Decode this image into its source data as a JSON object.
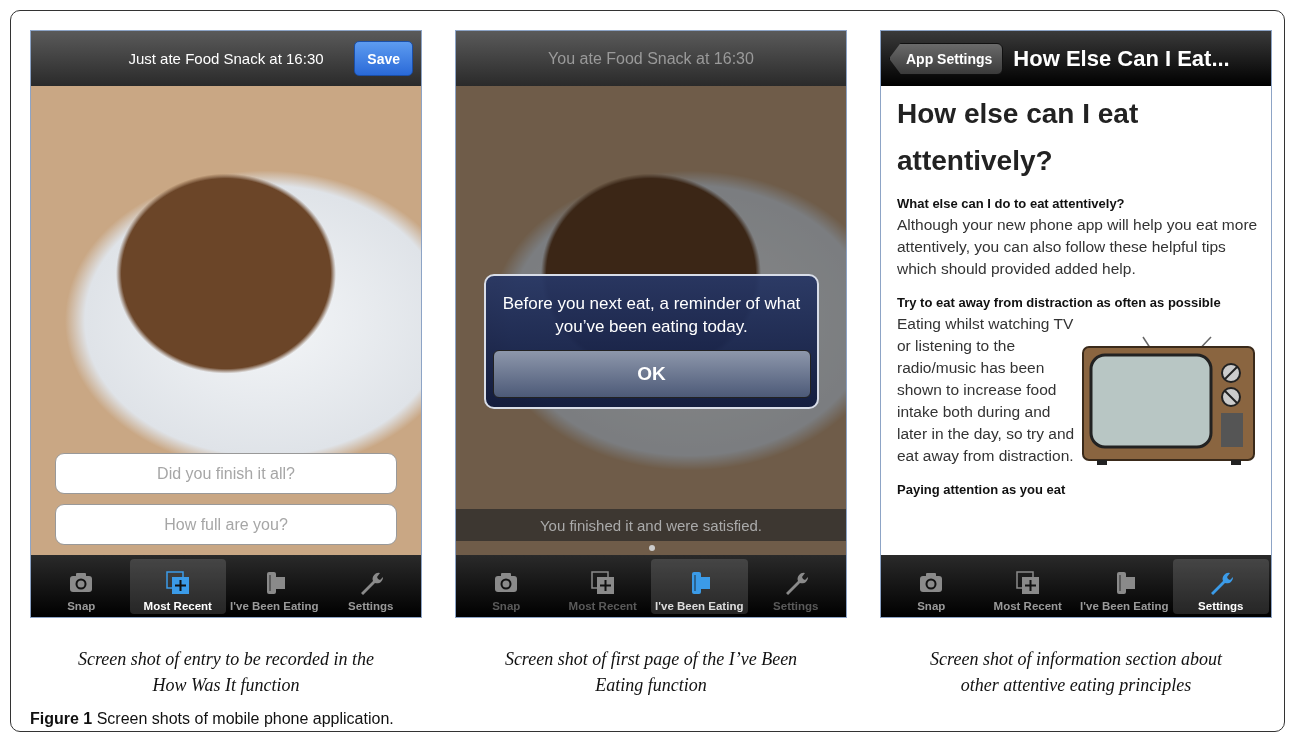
{
  "screens": [
    {
      "kind": "entry",
      "dimmed": false,
      "header": {
        "title": "Just ate Food Snack at 16:30",
        "button": "Save"
      },
      "fields": [
        {
          "placeholder": "Did you finish it all?"
        },
        {
          "placeholder": "How full are you?"
        }
      ],
      "tabs": [
        {
          "kind": "camera",
          "label": "Snap",
          "selected": false
        },
        {
          "kind": "add",
          "label": "Most Recent",
          "selected": true
        },
        {
          "kind": "film",
          "label": "I've Been Eating",
          "selected": false
        },
        {
          "kind": "wrench",
          "label": "Settings",
          "selected": false
        }
      ]
    },
    {
      "kind": "reminder",
      "dimmed": true,
      "header": {
        "title": "You ate Food Snack at 16:30"
      },
      "alert": {
        "message": "Before you next eat, a reminder of what you’ve been eating today.",
        "button": "OK"
      },
      "note": "You finished it and were satisfied.",
      "tabs": [
        {
          "kind": "camera",
          "label": "Snap",
          "selected": false
        },
        {
          "kind": "add",
          "label": "Most Recent",
          "selected": false
        },
        {
          "kind": "film",
          "label": "I've Been Eating",
          "selected": true
        },
        {
          "kind": "wrench",
          "label": "Settings",
          "selected": false
        }
      ]
    },
    {
      "kind": "info",
      "dimmed": false,
      "nav": {
        "back": "App Settings",
        "title": "How Else Can I Eat..."
      },
      "article": {
        "heading": "How else can I eat attentively?",
        "sections": [
          {
            "title": "What else can I do to eat attentively?",
            "text": "Although your new phone app will help you eat more attentively, you can also follow these helpful tips which should provided added help."
          },
          {
            "title": "Try to eat away from distraction as often as possible",
            "text": "Eating whilst watching TV or listening to the radio/music has been shown to increase food intake both during and later in the day, so try and eat away from distraction.",
            "kind": "tv"
          },
          {
            "title": "Paying attention as you eat"
          }
        ]
      },
      "tabs": [
        {
          "kind": "camera",
          "label": "Snap",
          "selected": false
        },
        {
          "kind": "add",
          "label": "Most Recent",
          "selected": false
        },
        {
          "kind": "film",
          "label": "I've Been Eating",
          "selected": false
        },
        {
          "kind": "wrench",
          "label": "Settings",
          "selected": true
        }
      ]
    }
  ],
  "captions": [
    "Screen shot of entry to be recorded in the How Was It function",
    "Screen shot of first page of the I’ve Been Eating function",
    "Screen shot of information section about other attentive eating principles"
  ],
  "figure_caption": "**Figure 1** Screen shots of mobile phone application."
}
